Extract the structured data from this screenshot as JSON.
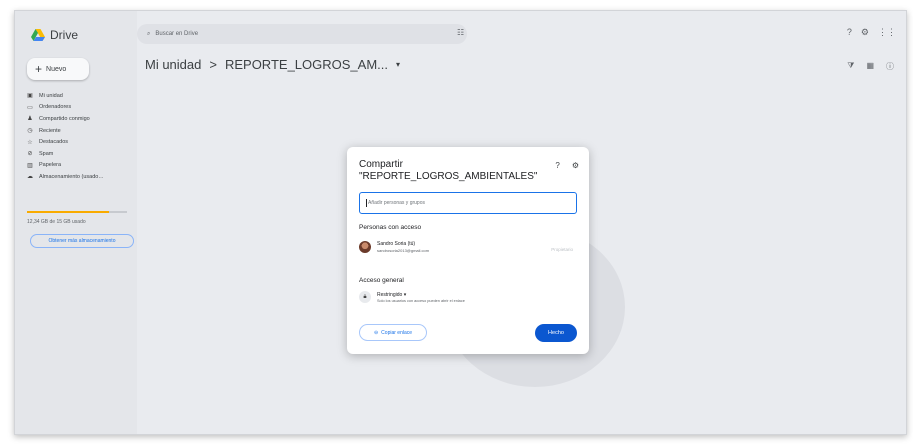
{
  "app": {
    "name": "Drive",
    "colors": {
      "accent": "#1a73e8",
      "primary_button": "#0b57d0",
      "storage_fill": "#f9ab00"
    }
  },
  "sidebar": {
    "new_label": "Nuevo",
    "items": [
      {
        "label": "Mi unidad",
        "icon": "my-drive-icon"
      },
      {
        "label": "Ordenadores",
        "icon": "computer-icon"
      },
      {
        "label": "Compartido conmigo",
        "icon": "shared-icon"
      },
      {
        "label": "Reciente",
        "icon": "clock-icon"
      },
      {
        "label": "Destacados",
        "icon": "star-icon"
      },
      {
        "label": "Spam",
        "icon": "spam-icon"
      },
      {
        "label": "Papelera",
        "icon": "trash-icon"
      },
      {
        "label": "Almacenamiento (usado…",
        "icon": "cloud-icon"
      }
    ],
    "storage": {
      "used_text": "12,34 GB de 15 GB usado",
      "fraction": 0.82
    },
    "more_storage_label": "Obtener más almacenamiento"
  },
  "topbar": {
    "search_placeholder": "Buscar en Drive"
  },
  "breadcrumb": {
    "root": "Mi unidad",
    "separator": ">",
    "current": "REPORTE_LOGROS_AM..."
  },
  "share_dialog": {
    "title_line1": "Compartir",
    "title_line2": "\"REPORTE_LOGROS_AMBIENTALES\"",
    "add_placeholder": "Añadir personas y grupos",
    "people_section": "Personas con acceso",
    "person": {
      "name": "Sandro Soria (tú)",
      "email": "sandrosoria2013@gmail.com",
      "role": "Propietario"
    },
    "general_section": "Acceso general",
    "access": {
      "level": "Restringido",
      "description": "Solo los usuarios con acceso pueden abrir el enlace"
    },
    "copy_link_label": "Copiar enlace",
    "done_label": "Hecho"
  }
}
